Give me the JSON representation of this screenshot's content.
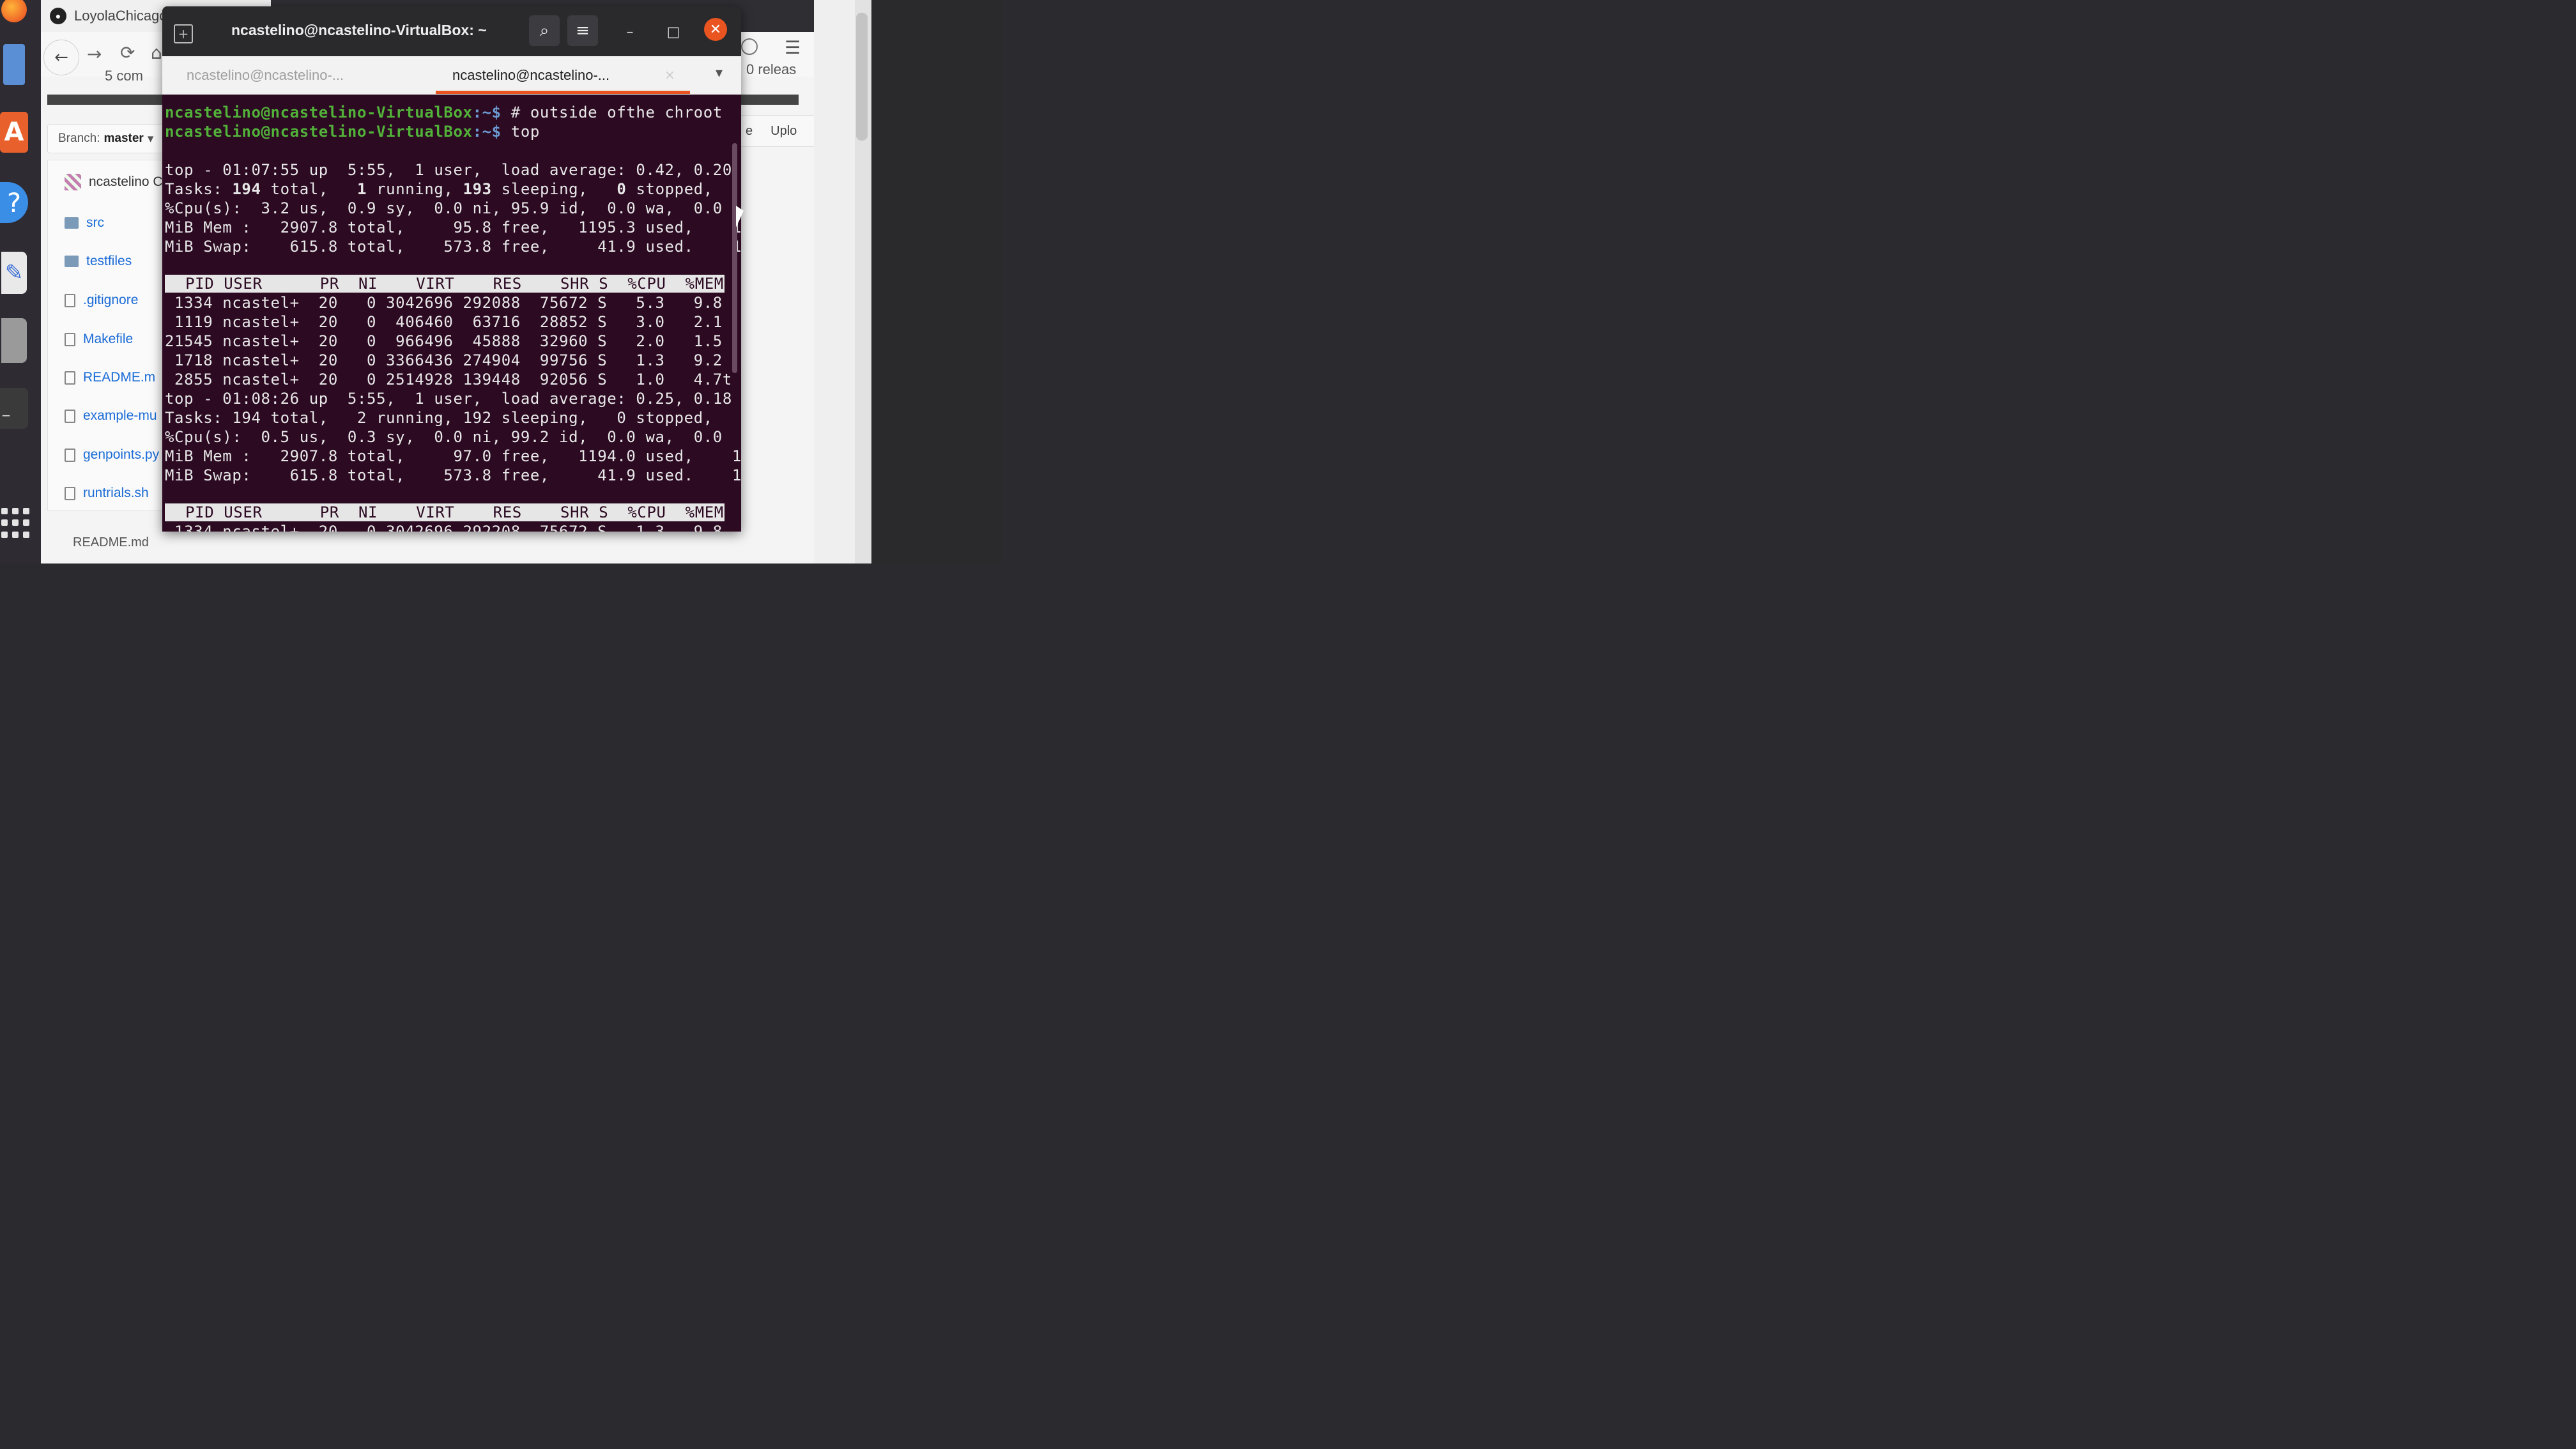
{
  "dock": {
    "items": [
      "firefox-icon",
      "files-icon",
      "software-icon",
      "help-icon",
      "editor-icon",
      "disk-icon",
      "terminal-icon",
      "show-apps-icon"
    ]
  },
  "browser": {
    "tab_title": "LoyolaChicagoCode/th",
    "commits": "5 com",
    "releases": "0 releas",
    "branch_label": "Branch:",
    "branch_value": "master",
    "owner": "ncastelino C",
    "upload_label": "Uplo",
    "files": [
      {
        "name": "src",
        "kind": "folder"
      },
      {
        "name": "testfiles",
        "kind": "folder"
      },
      {
        "name": ".gitignore",
        "kind": "file"
      },
      {
        "name": "Makefile",
        "kind": "file"
      },
      {
        "name": "README.m",
        "kind": "file"
      },
      {
        "name": "example-mu",
        "kind": "file"
      },
      {
        "name": "genpoints.py",
        "kind": "file"
      },
      {
        "name": "runtrials.sh",
        "kind": "file"
      }
    ],
    "readme_label": "README.md"
  },
  "terminal": {
    "window_title": "ncastelino@ncastelino-VirtualBox: ~",
    "tabs": [
      {
        "label": "ncastelino@ncastelino-...",
        "active": false
      },
      {
        "label": "ncastelino@ncastelino-...",
        "active": true
      }
    ],
    "accent": "#e95420",
    "prompt_user": "ncastelino@ncastelino-VirtualBox",
    "prompt_path": ":~$",
    "commands": [
      " # outside ofthe chroot",
      " top"
    ],
    "top1": {
      "summary": "top - 01:07:55 up  5:55,  1 user,  load average: 0.42, 0.20",
      "tasks_pre": "Tasks: ",
      "tasks_total": "194",
      "tasks_mid1": " total,   ",
      "tasks_running": "1",
      "tasks_mid2": " running, ",
      "tasks_sleeping": "193",
      "tasks_mid3": " sleeping,   ",
      "tasks_stopped": "0",
      "tasks_end": " stopped,",
      "cpu": "%Cpu(s):  3.2 us,  0.9 sy,  0.0 ni, 95.9 id,  0.0 wa,  0.0",
      "mem": "MiB Mem :   2907.8 total,     95.8 free,   1195.3 used,    1",
      "swap": "MiB Swap:    615.8 total,    573.8 free,     41.9 used.    1",
      "header": "  PID USER      PR  NI    VIRT    RES    SHR S  %CPU  %MEM",
      "rows": [
        " 1334 ncastel+  20   0 3042696 292088  75672 S   5.3   9.8",
        " 1119 ncastel+  20   0  406460  63716  28852 S   3.0   2.1",
        "21545 ncastel+  20   0  966496  45888  32960 S   2.0   1.5",
        " 1718 ncastel+  20   0 3366436 274904  99756 S   1.3   9.2",
        " 2855 ncastel+  20   0 2514928 139448  92056 S   1.0   4.7t"
      ]
    },
    "top2": {
      "summary": "top - 01:08:26 up  5:55,  1 user,  load average: 0.25, 0.18",
      "tasks": "Tasks: 194 total,   2 running, 192 sleeping,   0 stopped,",
      "cpu": "%Cpu(s):  0.5 us,  0.3 sy,  0.0 ni, 99.2 id,  0.0 wa,  0.0",
      "mem": "MiB Mem :   2907.8 total,     97.0 free,   1194.0 used,    1",
      "swap": "MiB Swap:    615.8 total,    573.8 free,     41.9 used.    1",
      "header": "  PID USER      PR  NI    VIRT    RES    SHR S  %CPU  %MEM",
      "rows": [
        " 1334 ncastel+  20   0 3042696 292208  75672 S   1.3   9.8"
      ]
    }
  }
}
